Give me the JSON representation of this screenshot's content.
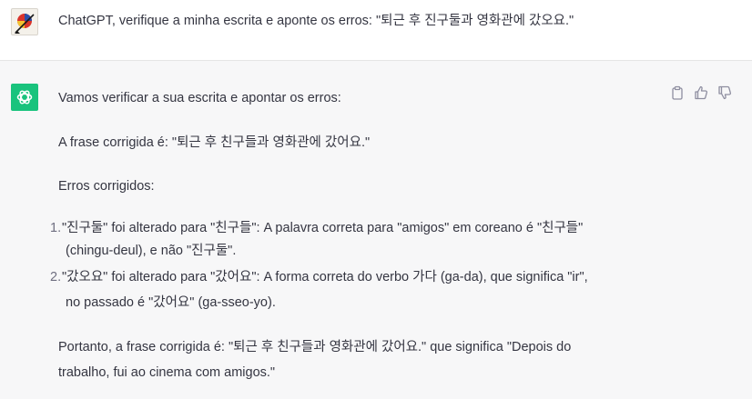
{
  "user": {
    "avatar_icon": "user-avatar-icon",
    "message": "ChatGPT, verifique a minha escrita e aponte os erros: \"퇴근 후 진구둘과 영화관에 갔오요.\""
  },
  "assistant": {
    "avatar_icon": "openai-logo-icon",
    "accent": "#19c37d",
    "intro": "Vamos verificar a sua escrita e apontar os erros:",
    "corrected": "A frase corrigida é: \"퇴근 후 친구들과 영화관에 갔어요.\"",
    "errors_heading": "Erros corrigidos:",
    "items": [
      {
        "num": "1.",
        "line1": "\"진구둘\" foi alterado para \"친구들\": A palavra correta para \"amigos\" em coreano é \"친구들\"",
        "line2": "(chingu-deul), e não \"진구둘\"."
      },
      {
        "num": "2.",
        "line1": "\"갔오요\" foi alterado para \"갔어요\": A forma correta do verbo 가다 (ga-da), que significa \"ir\",",
        "line2": "no passado é \"갔어요\" (ga-sseo-yo)."
      }
    ],
    "conclusion_line1": "Portanto, a frase corrigida é: \"퇴근 후 친구들과 영화관에 갔어요.\" que significa \"Depois do",
    "conclusion_line2": "trabalho, fui ao cinema com amigos.\""
  },
  "actions": {
    "copy_icon": "clipboard-icon",
    "like_icon": "thumbs-up-icon",
    "dislike_icon": "thumbs-down-icon"
  }
}
